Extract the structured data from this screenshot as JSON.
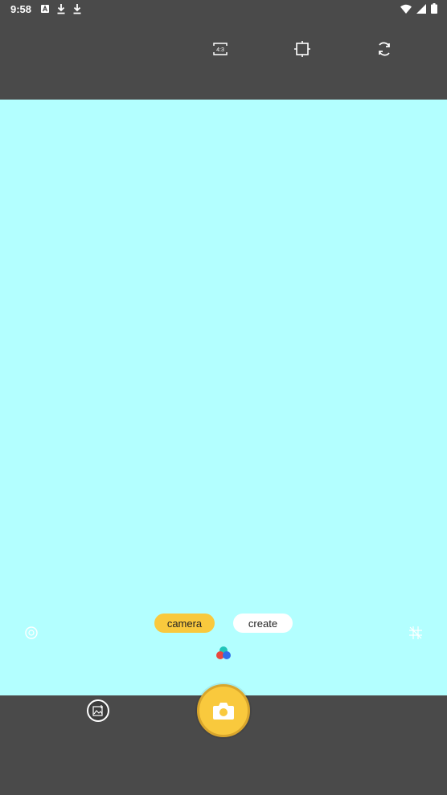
{
  "status_bar": {
    "time": "9:58",
    "left_icons": [
      "text-icon",
      "download-icon",
      "download-icon"
    ],
    "right_icons": [
      "wifi-icon",
      "signal-icon",
      "battery-icon"
    ]
  },
  "toolbar": {
    "buttons": [
      {
        "name": "aspect-ratio-button",
        "label": "4:3"
      },
      {
        "name": "crop-button",
        "icon": "crop-icon"
      },
      {
        "name": "switch-camera-button",
        "icon": "rotate-icon"
      }
    ]
  },
  "modes": {
    "camera_label": "camera",
    "create_label": "create",
    "active": "camera"
  },
  "colors": {
    "accent": "#f9c93d",
    "viewfinder": "#b3ffff",
    "chrome": "#4a4a4a"
  }
}
